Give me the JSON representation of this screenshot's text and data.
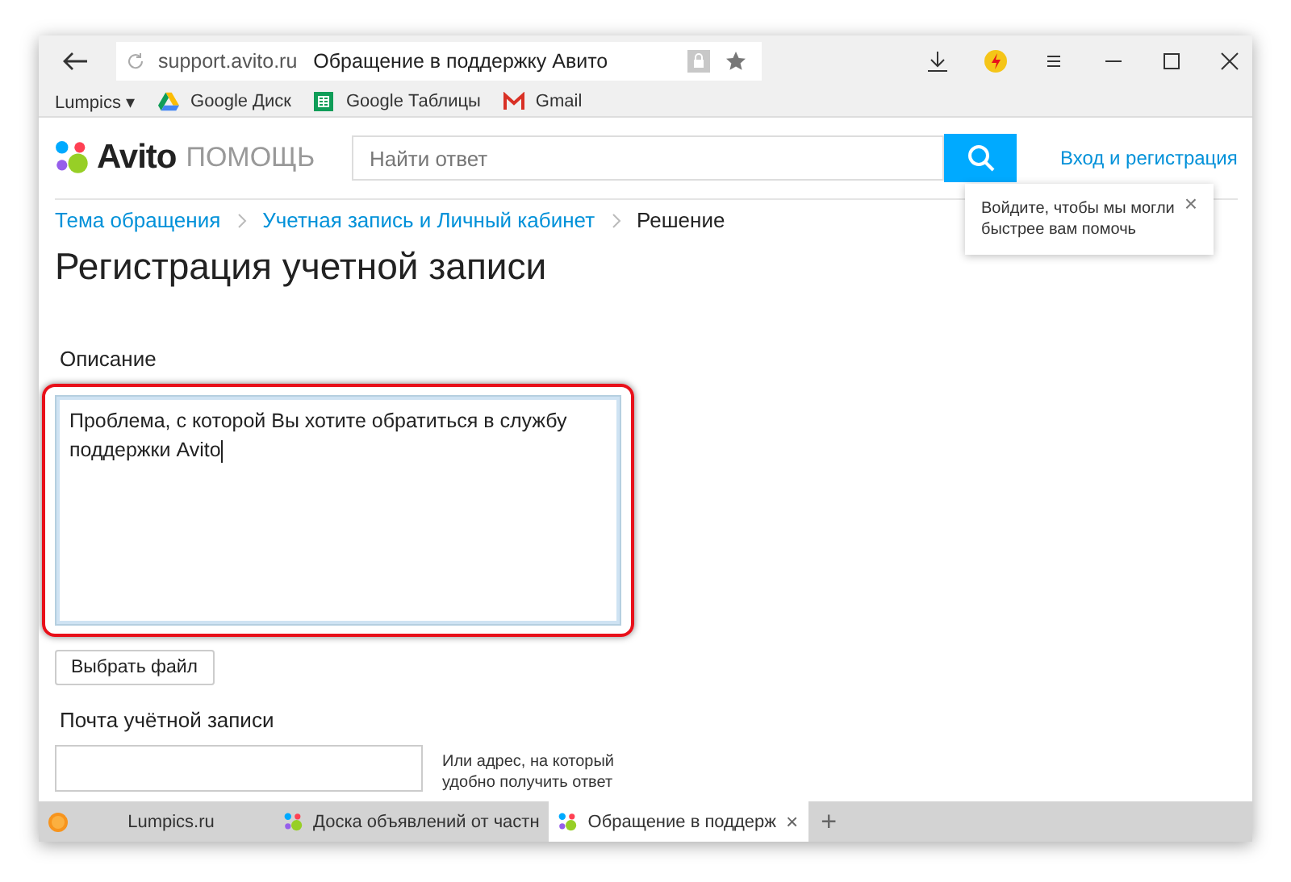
{
  "browser": {
    "url": "support.avito.ru",
    "page_title": "Обращение в поддержку Авито"
  },
  "bookmarks": [
    {
      "label": "Lumpics ▾",
      "kind": "folder"
    },
    {
      "label": "Google Диск",
      "kind": "drive"
    },
    {
      "label": "Google Таблицы",
      "kind": "sheets"
    },
    {
      "label": "Gmail",
      "kind": "gmail"
    }
  ],
  "header": {
    "logo_text": "Avito",
    "logo_subtitle": "ПОМОЩЬ",
    "search": {
      "placeholder": "Найти ответ"
    },
    "login_link": "Вход и регистрация"
  },
  "popup": {
    "text": "Войдите, чтобы мы могли быстрее вам помочь",
    "close": "×"
  },
  "breadcrumbs": [
    {
      "label": "Тема обращения",
      "kind": "link"
    },
    {
      "label": "Учетная запись и Личный кабинет",
      "kind": "link"
    },
    {
      "label": "Решение",
      "kind": "current"
    }
  ],
  "title": "Регистрация учетной записи",
  "description": {
    "label": "Описание",
    "value": "Проблема, с которой Вы хотите обратиться в службу поддержки Avito",
    "highlighted": true
  },
  "file_button": "Выбрать файл",
  "email": {
    "label": "Почта учётной записи",
    "hint": "Или адрес, на который удобно получить ответ"
  },
  "tabs": [
    {
      "label": "Lumpics.ru",
      "kind": "lumpics",
      "selected": false
    },
    {
      "label": "Доска объявлений от частн",
      "kind": "avito",
      "selected": false
    },
    {
      "label": "Обращение в поддерж",
      "kind": "avito",
      "selected": true,
      "close": "×"
    }
  ],
  "new_tab": "+"
}
